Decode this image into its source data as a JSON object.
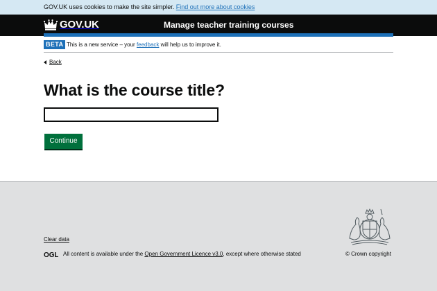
{
  "cookie_banner": {
    "text": "GOV.UK uses cookies to make the site simpler.",
    "link_label": "Find out more about cookies"
  },
  "header": {
    "logo_text": "GOV.UK",
    "service_name": "Manage teacher training courses",
    "logo_icon": "crown-icon"
  },
  "phase_banner": {
    "tag": "BETA",
    "text_before": "This is a new service – your",
    "link_label": "feedback",
    "text_after": "will help us to improve it."
  },
  "back_link": {
    "label": "Back",
    "icon": "chevron-left-icon"
  },
  "form": {
    "question": "What is the course title?",
    "input_value": "",
    "button_label": "Continue"
  },
  "footer": {
    "clear_data_label": "Clear data",
    "ogl_label": "OGL",
    "licence_before": "All content is available under the",
    "licence_link": "Open Government Licence v3.0",
    "licence_after": ", except where otherwise stated",
    "copyright": "© Crown copyright",
    "crest_icon": "royal-coat-of-arms-icon"
  },
  "colors": {
    "cookie_banner_bg": "#d5e8f3",
    "header_bg": "#0b0c0c",
    "accent_blue": "#1d70b8",
    "button_green": "#00703c",
    "footer_bg": "#dfe0e1",
    "text": "#0b0c0c"
  }
}
